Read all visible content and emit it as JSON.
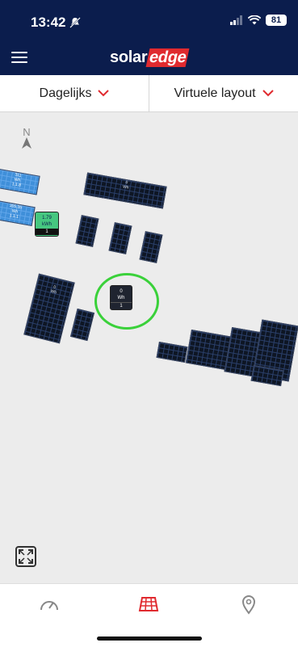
{
  "status_bar": {
    "time": "13:42",
    "battery": "81"
  },
  "header": {
    "brand_left": "solar",
    "brand_right": "edge"
  },
  "selectors": {
    "period": "Dagelijks",
    "view": "Virtuele layout"
  },
  "compass": {
    "label": "N"
  },
  "layout": {
    "blue_panels": [
      {
        "lines": [
          "311",
          "Wh",
          "1.1.8"
        ]
      },
      {
        "lines": [
          "305.35",
          "Wh",
          "1.1.1"
        ]
      }
    ],
    "inverters": [
      {
        "type": "green",
        "lines": [
          "1.79",
          "kWh"
        ],
        "id": "1"
      },
      {
        "type": "dark",
        "lines": [
          "0",
          "Wh"
        ],
        "id": "1"
      }
    ],
    "dark_panel_lines": [
      "0",
      "Wh"
    ]
  },
  "colors": {
    "brand_blue": "#0b1d4d",
    "brand_red": "#e02a2f",
    "highlight_green": "#3ad13a",
    "panel_blue": "#3f8fd9",
    "inverter_green": "#46c780"
  }
}
